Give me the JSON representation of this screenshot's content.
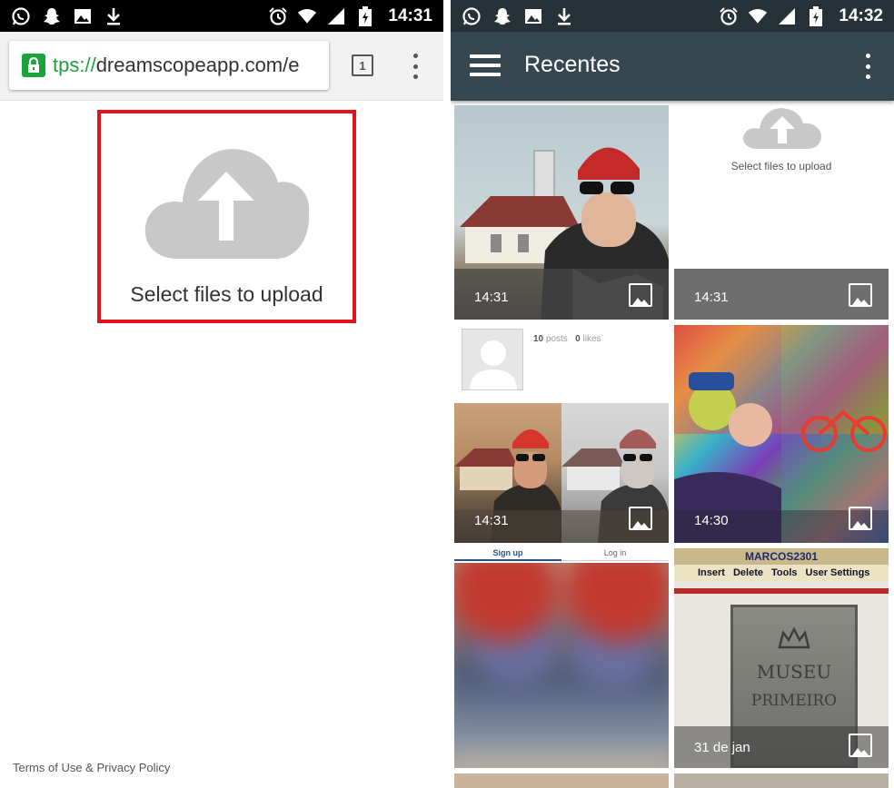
{
  "left": {
    "status_time": "14:31",
    "url_scheme": "tps://",
    "url_host": "dreamscopeapp.com/e",
    "tab_count": "1",
    "upload_label": "Select files to upload",
    "footer": "Terms of Use & Privacy Policy"
  },
  "right": {
    "status_time": "14:32",
    "title": "Recentes",
    "mini_upload_label": "Select files to upload",
    "profile": {
      "posts_count": "10",
      "posts_label": "posts",
      "likes_count": "0",
      "likes_label": "likes"
    },
    "tabs": [
      "Sign up",
      "Log in"
    ],
    "tiles": [
      {
        "time": "14:31"
      },
      {
        "time": "14:31"
      },
      {
        "time": "14:31"
      },
      {
        "time": "14:30"
      },
      {
        "time": "31 de jan"
      }
    ],
    "screenshot_text": {
      "username": "MARCOS2301",
      "menu": [
        "Insert",
        "Delete",
        "Tools",
        "User Settings"
      ],
      "sign": "MUSEU",
      "sign2": "PRIMEIRO"
    }
  },
  "colors": {
    "highlight_red": "#e1141b",
    "toolbar": "#37474f",
    "chrome_green": "#1aa33a"
  }
}
